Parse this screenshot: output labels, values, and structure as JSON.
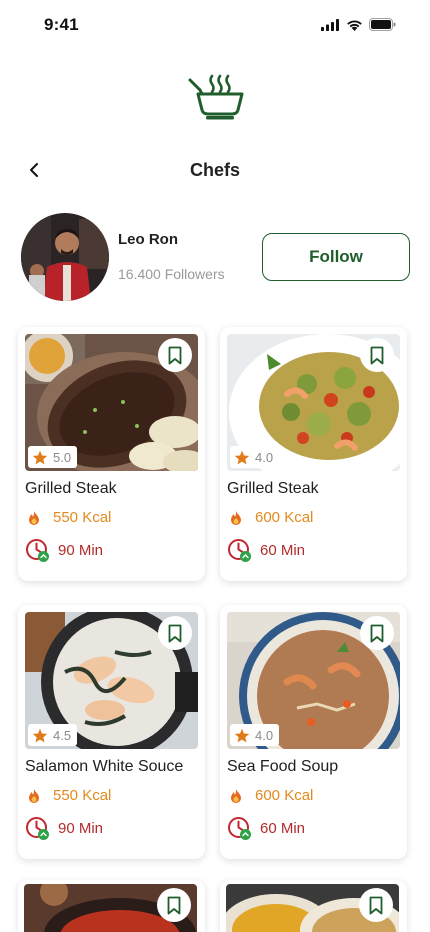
{
  "status_bar": {
    "time": "9:41"
  },
  "header": {
    "title": "Chefs"
  },
  "chef": {
    "name": "Leo Ron",
    "followers": "16.400 Followers",
    "follow_label": "Follow"
  },
  "colors": {
    "brand_green": "#1f5e2c",
    "kcal_orange": "#e38a1e",
    "time_red": "#b22b2b",
    "star_orange": "#e07b1a"
  },
  "recipes": [
    {
      "title": "Grilled Steak",
      "rating": "5.0",
      "kcal": "550 Kcal",
      "time": "90 Min"
    },
    {
      "title": "Grilled Steak",
      "rating": "4.0",
      "kcal": "600 Kcal",
      "time": "60 Min"
    },
    {
      "title": "Salamon White Souce",
      "rating": "4.5",
      "kcal": "550 Kcal",
      "time": "90 Min"
    },
    {
      "title": "Sea Food Soup",
      "rating": "4.0",
      "kcal": "600 Kcal",
      "time": "60 Min"
    }
  ],
  "icons": {
    "logo": "cooking-pot-logo-icon",
    "back": "chevron-left-icon",
    "bookmark": "bookmark-icon",
    "rating": "star-icon",
    "kcal": "flame-icon",
    "time": "clock-icon"
  }
}
